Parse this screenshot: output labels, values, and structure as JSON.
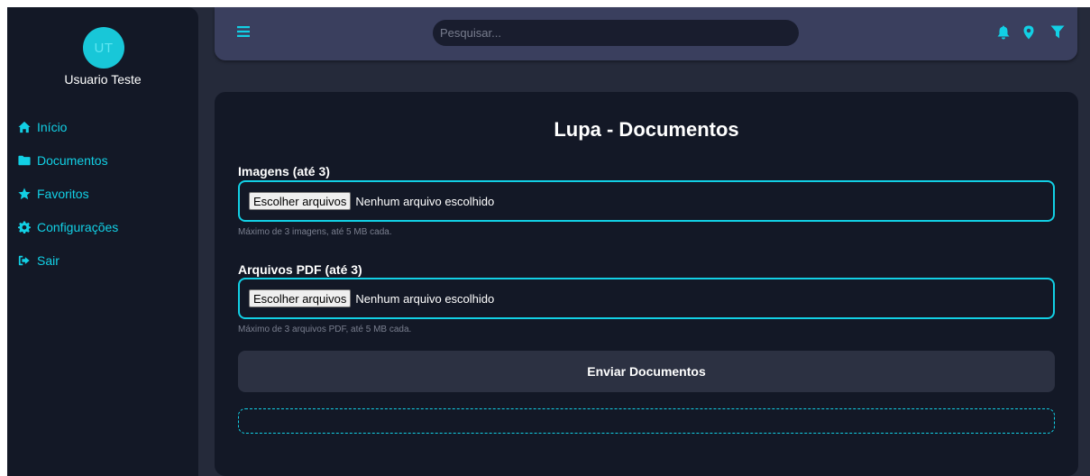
{
  "colors": {
    "accent": "#12d0e5",
    "sidebar_bg": "#131826",
    "topbar_bg": "#3a3f5e",
    "content_bg": "#252a3a"
  },
  "user": {
    "initials": "UT",
    "name": "Usuario Teste"
  },
  "sidebar": {
    "items": [
      {
        "label": "Início",
        "icon": "home-icon"
      },
      {
        "label": "Documentos",
        "icon": "folder-icon"
      },
      {
        "label": "Favoritos",
        "icon": "star-icon"
      },
      {
        "label": "Configurações",
        "icon": "gear-icon"
      },
      {
        "label": "Sair",
        "icon": "sign-out-icon"
      }
    ]
  },
  "topbar": {
    "menu_icon": "menu-icon",
    "search_placeholder": "Pesquisar...",
    "icons": [
      "bell-icon",
      "map-marker-icon",
      "filter-icon"
    ]
  },
  "main": {
    "title": "Lupa - Documentos",
    "images": {
      "label": "Imagens (até 3)",
      "button": "Escolher arquivos",
      "status": "Nenhum arquivo escolhido",
      "hint": "Máximo de 3 imagens, até 5 MB cada."
    },
    "pdfs": {
      "label": "Arquivos PDF (até 3)",
      "button": "Escolher arquivos",
      "status": "Nenhum arquivo escolhido",
      "hint": "Máximo de 3 arquivos PDF, até 5 MB cada."
    },
    "submit_label": "Enviar Documentos"
  }
}
